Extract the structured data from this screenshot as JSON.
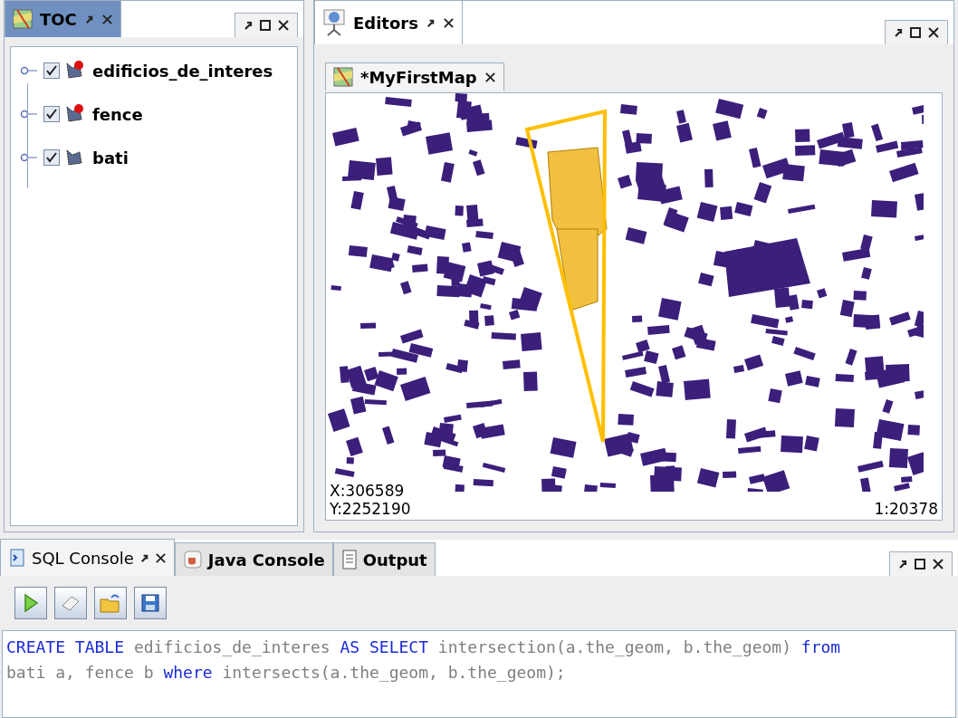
{
  "toc": {
    "tab": {
      "label": "TOC",
      "selected": true
    },
    "layers": [
      {
        "name": "edificios_de_interes",
        "checked": true,
        "kind": "selected-layer"
      },
      {
        "name": "fence",
        "checked": true,
        "kind": "selected-layer"
      },
      {
        "name": "bati",
        "checked": true,
        "kind": "layer"
      }
    ]
  },
  "editors": {
    "tab": {
      "label": "Editors",
      "selected": true
    },
    "document_tabs": [
      {
        "label": "*MyFirstMap",
        "selected": true
      }
    ],
    "map": {
      "x": "X:306589",
      "y": "Y:2252190",
      "scale": "1:20378"
    }
  },
  "console": {
    "tabs": [
      {
        "label": "SQL Console",
        "selected": true,
        "kind": "sql"
      },
      {
        "label": "Java Console",
        "selected": false,
        "kind": "java"
      },
      {
        "label": "Output",
        "selected": false,
        "kind": "output"
      }
    ],
    "toolbar": [
      {
        "kind": "run"
      },
      {
        "kind": "clear"
      },
      {
        "kind": "open"
      },
      {
        "kind": "save"
      }
    ],
    "code_lines": [
      [
        {
          "text": "CREATE TABLE",
          "kind": "keyword"
        },
        {
          "text": " edificios_de_interes ",
          "kind": "text"
        },
        {
          "text": "AS SELECT",
          "kind": "keyword"
        },
        {
          "text": " intersection(a.the_geom, b.the_geom) ",
          "kind": "text"
        },
        {
          "text": "from",
          "kind": "keyword"
        }
      ],
      [
        {
          "text": "bati a, fence b ",
          "kind": "text"
        },
        {
          "text": "where",
          "kind": "keyword"
        },
        {
          "text": " intersects(a.the_geom, b.the_geom);",
          "kind": "text"
        }
      ]
    ]
  }
}
